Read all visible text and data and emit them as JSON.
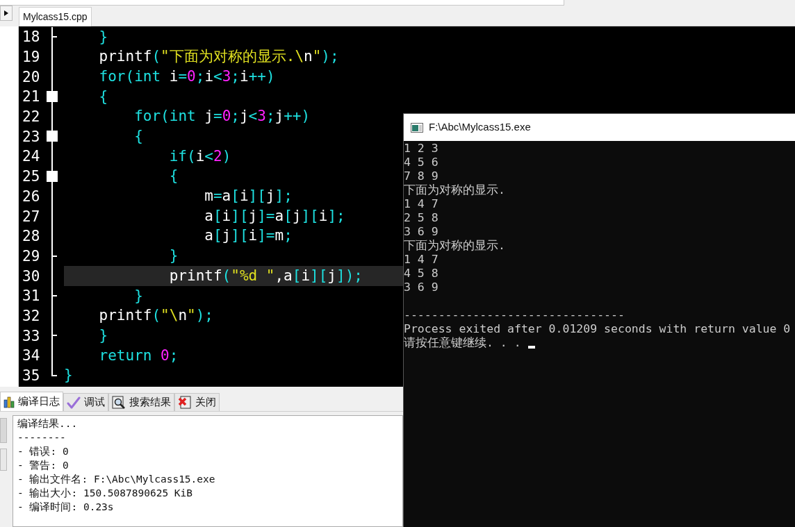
{
  "editor_tab": {
    "label": "Mylcass15.cpp",
    "selected": true
  },
  "code_lines": [
    {
      "number": "18",
      "fold": {
        "kind": "tick"
      },
      "current": false,
      "tokens": [
        {
          "kind": "op",
          "text": "    }"
        }
      ]
    },
    {
      "number": "19",
      "fold": {
        "kind": "line"
      },
      "current": false,
      "tokens": [
        {
          "kind": "id",
          "text": "    printf"
        },
        {
          "kind": "op",
          "text": "("
        },
        {
          "kind": "str",
          "text": "\"下面为对称的显示.\\"
        },
        {
          "kind": "esc",
          "text": "n"
        },
        {
          "kind": "str",
          "text": "\""
        },
        {
          "kind": "op",
          "text": ");"
        }
      ]
    },
    {
      "number": "20",
      "fold": {
        "kind": "line"
      },
      "current": false,
      "tokens": [
        {
          "kind": "kw",
          "text": "    for"
        },
        {
          "kind": "op",
          "text": "("
        },
        {
          "kind": "kw",
          "text": "int"
        },
        {
          "kind": "id",
          "text": " i"
        },
        {
          "kind": "op",
          "text": "="
        },
        {
          "kind": "num",
          "text": "0"
        },
        {
          "kind": "op",
          "text": ";"
        },
        {
          "kind": "id",
          "text": "i"
        },
        {
          "kind": "op",
          "text": "<"
        },
        {
          "kind": "num",
          "text": "3"
        },
        {
          "kind": "op",
          "text": ";"
        },
        {
          "kind": "id",
          "text": "i"
        },
        {
          "kind": "op",
          "text": "++)"
        }
      ]
    },
    {
      "number": "21",
      "fold": {
        "kind": "box"
      },
      "current": false,
      "tokens": [
        {
          "kind": "op",
          "text": "    {"
        }
      ]
    },
    {
      "number": "22",
      "fold": {
        "kind": "line"
      },
      "current": false,
      "tokens": [
        {
          "kind": "kw",
          "text": "        for"
        },
        {
          "kind": "op",
          "text": "("
        },
        {
          "kind": "kw",
          "text": "int"
        },
        {
          "kind": "id",
          "text": " j"
        },
        {
          "kind": "op",
          "text": "="
        },
        {
          "kind": "num",
          "text": "0"
        },
        {
          "kind": "op",
          "text": ";"
        },
        {
          "kind": "id",
          "text": "j"
        },
        {
          "kind": "op",
          "text": "<"
        },
        {
          "kind": "num",
          "text": "3"
        },
        {
          "kind": "op",
          "text": ";"
        },
        {
          "kind": "id",
          "text": "j"
        },
        {
          "kind": "op",
          "text": "++)"
        }
      ]
    },
    {
      "number": "23",
      "fold": {
        "kind": "box"
      },
      "current": false,
      "tokens": [
        {
          "kind": "op",
          "text": "        {"
        }
      ]
    },
    {
      "number": "24",
      "fold": {
        "kind": "line"
      },
      "current": false,
      "tokens": [
        {
          "kind": "kw",
          "text": "            if"
        },
        {
          "kind": "op",
          "text": "("
        },
        {
          "kind": "id",
          "text": "i"
        },
        {
          "kind": "op",
          "text": "<"
        },
        {
          "kind": "num",
          "text": "2"
        },
        {
          "kind": "op",
          "text": ")"
        }
      ]
    },
    {
      "number": "25",
      "fold": {
        "kind": "box"
      },
      "current": false,
      "tokens": [
        {
          "kind": "op",
          "text": "            {"
        }
      ]
    },
    {
      "number": "26",
      "fold": {
        "kind": "line"
      },
      "current": false,
      "tokens": [
        {
          "kind": "id",
          "text": "                m"
        },
        {
          "kind": "op",
          "text": "="
        },
        {
          "kind": "id",
          "text": "a"
        },
        {
          "kind": "op",
          "text": "["
        },
        {
          "kind": "id",
          "text": "i"
        },
        {
          "kind": "op",
          "text": "]["
        },
        {
          "kind": "id",
          "text": "j"
        },
        {
          "kind": "op",
          "text": "];"
        }
      ]
    },
    {
      "number": "27",
      "fold": {
        "kind": "line"
      },
      "current": false,
      "tokens": [
        {
          "kind": "id",
          "text": "                a"
        },
        {
          "kind": "op",
          "text": "["
        },
        {
          "kind": "id",
          "text": "i"
        },
        {
          "kind": "op",
          "text": "]["
        },
        {
          "kind": "id",
          "text": "j"
        },
        {
          "kind": "op",
          "text": "]="
        },
        {
          "kind": "id",
          "text": "a"
        },
        {
          "kind": "op",
          "text": "["
        },
        {
          "kind": "id",
          "text": "j"
        },
        {
          "kind": "op",
          "text": "]["
        },
        {
          "kind": "id",
          "text": "i"
        },
        {
          "kind": "op",
          "text": "];"
        }
      ]
    },
    {
      "number": "28",
      "fold": {
        "kind": "line"
      },
      "current": false,
      "tokens": [
        {
          "kind": "id",
          "text": "                a"
        },
        {
          "kind": "op",
          "text": "["
        },
        {
          "kind": "id",
          "text": "j"
        },
        {
          "kind": "op",
          "text": "]["
        },
        {
          "kind": "id",
          "text": "i"
        },
        {
          "kind": "op",
          "text": "]="
        },
        {
          "kind": "id",
          "text": "m"
        },
        {
          "kind": "op",
          "text": ";"
        }
      ]
    },
    {
      "number": "29",
      "fold": {
        "kind": "tick"
      },
      "current": false,
      "tokens": [
        {
          "kind": "op",
          "text": "            }"
        }
      ]
    },
    {
      "number": "30",
      "fold": {
        "kind": "line"
      },
      "current": true,
      "tokens": [
        {
          "kind": "id",
          "text": "            printf"
        },
        {
          "kind": "op",
          "text": "("
        },
        {
          "kind": "str",
          "text": "\"%d \""
        },
        {
          "kind": "id",
          "text": ",a"
        },
        {
          "kind": "op",
          "text": "["
        },
        {
          "kind": "id",
          "text": "i"
        },
        {
          "kind": "op",
          "text": "]["
        },
        {
          "kind": "id",
          "text": "j"
        },
        {
          "kind": "op",
          "text": "]);"
        }
      ]
    },
    {
      "number": "31",
      "fold": {
        "kind": "tick"
      },
      "current": false,
      "tokens": [
        {
          "kind": "op",
          "text": "        }"
        }
      ]
    },
    {
      "number": "32",
      "fold": {
        "kind": "line"
      },
      "current": false,
      "tokens": [
        {
          "kind": "id",
          "text": "    printf"
        },
        {
          "kind": "op",
          "text": "("
        },
        {
          "kind": "str",
          "text": "\"\\"
        },
        {
          "kind": "esc",
          "text": "n"
        },
        {
          "kind": "str",
          "text": "\""
        },
        {
          "kind": "op",
          "text": ");"
        }
      ]
    },
    {
      "number": "33",
      "fold": {
        "kind": "tick"
      },
      "current": false,
      "tokens": [
        {
          "kind": "op",
          "text": "    }"
        }
      ]
    },
    {
      "number": "34",
      "fold": {
        "kind": "line"
      },
      "current": false,
      "tokens": [
        {
          "kind": "kw",
          "text": "    return "
        },
        {
          "kind": "num",
          "text": "0"
        },
        {
          "kind": "op",
          "text": ";"
        }
      ]
    },
    {
      "number": "35",
      "fold": {
        "kind": "end"
      },
      "current": false,
      "tokens": [
        {
          "kind": "op",
          "text": "}"
        }
      ]
    }
  ],
  "bottom_tabs": [
    {
      "kind": "log",
      "label": "编译日志",
      "selected": true
    },
    {
      "kind": "debug",
      "label": "调试",
      "selected": false
    },
    {
      "kind": "search",
      "label": "搜索结果",
      "selected": false
    },
    {
      "kind": "close",
      "label": "关闭",
      "selected": false
    }
  ],
  "compile_log": [
    "编译结果...",
    "--------",
    "- 错误: 0",
    "- 警告: 0",
    "- 输出文件名: F:\\Abc\\Mylcass15.exe",
    "- 输出大小: 150.5087890625 KiB",
    "- 编译时间: 0.23s"
  ],
  "console": {
    "title": "F:\\Abc\\Mylcass15.exe",
    "output": [
      "1 2 3",
      "4 5 6",
      "7 8 9",
      "下面为对称的显示.",
      "1 4 7",
      "2 5 8",
      "3 6 9",
      "下面为对称的显示.",
      "1 4 7",
      "4 5 8",
      "3 6 9"
    ],
    "footer": [
      "--------------------------------",
      "Process exited after 0.01209 seconds with return value 0",
      "请按任意键继续. . ."
    ]
  }
}
